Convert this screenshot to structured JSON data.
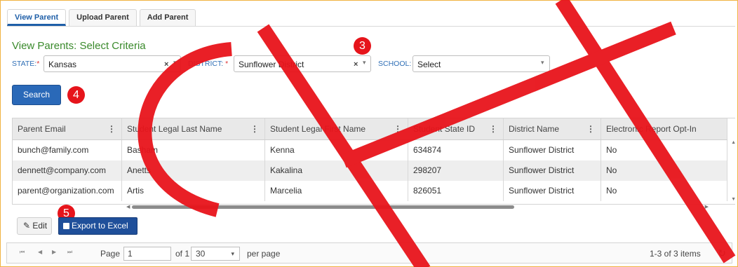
{
  "tabs": [
    {
      "label": "View Parent",
      "active": true
    },
    {
      "label": "Upload Parent",
      "active": false
    },
    {
      "label": "Add Parent",
      "active": false
    }
  ],
  "title": "View Parents: Select Criteria",
  "criteria": {
    "state_label": "STATE:",
    "state_value": "Kansas",
    "district_label": "DISTRICT:",
    "district_value": "Sunflower District",
    "school_label": "SCHOOL:",
    "school_value": "Select",
    "required_mark": "*",
    "clear_glyph": "×",
    "caret_glyph": "▾"
  },
  "search_label": "Search",
  "badges": {
    "b3": "3",
    "b4": "4",
    "b5": "5"
  },
  "grid": {
    "menu_glyph": "⋮",
    "columns": [
      "Parent Email",
      "Student Legal Last Name",
      "Student Legal First Name",
      "Student State ID",
      "District Name",
      "Electronic Report Opt-In"
    ],
    "rows": [
      [
        "bunch@family.com",
        "Basham",
        "Kenna",
        "634874",
        "Sunflower District",
        "No"
      ],
      [
        "dennett@company.com",
        "Anetts",
        "Kakalina",
        "298207",
        "Sunflower District",
        "No"
      ],
      [
        "parent@organization.com",
        "Artis",
        "Marcelia",
        "826051",
        "Sunflower District",
        "No"
      ]
    ]
  },
  "actions": {
    "edit_label": "Edit",
    "export_label": "Export to Excel"
  },
  "pager": {
    "page_label": "Page",
    "page_value": "1",
    "of_label": "of 1",
    "page_size": "30",
    "per_page_label": "per page",
    "items_label": "1-3 of 3 items"
  },
  "colors": {
    "accent": "#2a69b8",
    "title": "#3a8a2c",
    "badge": "#e6141b",
    "watermark": "#e8141b"
  }
}
